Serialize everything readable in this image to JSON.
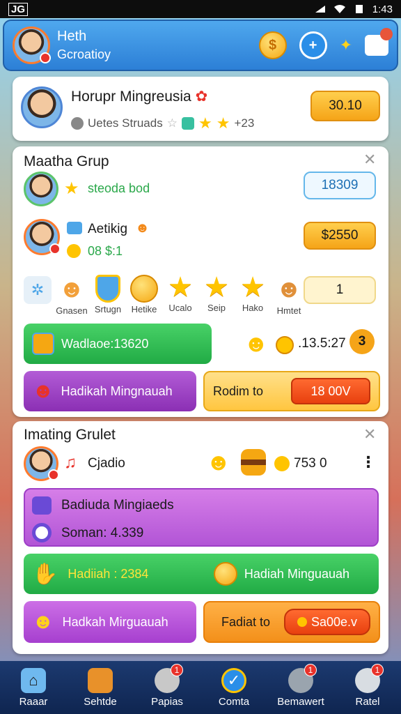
{
  "status_bar": {
    "left": "JG",
    "time": "1:43"
  },
  "header": {
    "name": "Heth",
    "subtitle": "Gcroatioy"
  },
  "profile_card": {
    "title": "Horupr Mingreusia",
    "subline": "Uetes Struads",
    "count": "+23",
    "button": "30.10"
  },
  "match_group": {
    "title": "Maatha Grup",
    "player1": {
      "name": "steoda bod",
      "value": "18309"
    },
    "player2": {
      "name": "Aetikig",
      "stat": "08 $:1",
      "value": "$2550"
    },
    "rewards": [
      {
        "label": "Gnasen"
      },
      {
        "label": "Srtugn"
      },
      {
        "label": "Hetike"
      },
      {
        "label": "Ucalo"
      },
      {
        "label": "Seip"
      },
      {
        "label": "Hako"
      },
      {
        "label": "Hmtet"
      }
    ],
    "reward_count": "1",
    "green_bar": "Wadlaoe:13620",
    "timer": ".13.5:27",
    "timer_badge": "3",
    "purple_bar": "Hadikah Mingnauah",
    "redeem_label": "Rodim to",
    "redeem_button": "18 00V"
  },
  "second_group": {
    "title": "Imating Grulet",
    "player": {
      "name": "Cjadio",
      "value": "753 0"
    },
    "purple_line1": "Badiuda Mingiaeds",
    "purple_line2": "Soman: 4.339",
    "green_left": "Hadiiah : 2384",
    "green_right": "Hadiah Minguauah",
    "purple_bar": "Hadkah Mirguauah",
    "orange_label": "Fadiat to",
    "orange_button": "Sa00e.v"
  },
  "bottom_nav": [
    {
      "label": "Raaar",
      "icon": "house-icon",
      "badge": ""
    },
    {
      "label": "Sehtde",
      "icon": "chest-icon",
      "badge": ""
    },
    {
      "label": "Papias",
      "icon": "coins-icon",
      "badge": "1"
    },
    {
      "label": "Comta",
      "icon": "check-icon",
      "badge": ""
    },
    {
      "label": "Bemawert",
      "icon": "pet-icon",
      "badge": "1"
    },
    {
      "label": "Ratel",
      "icon": "cat-icon",
      "badge": "1"
    }
  ]
}
